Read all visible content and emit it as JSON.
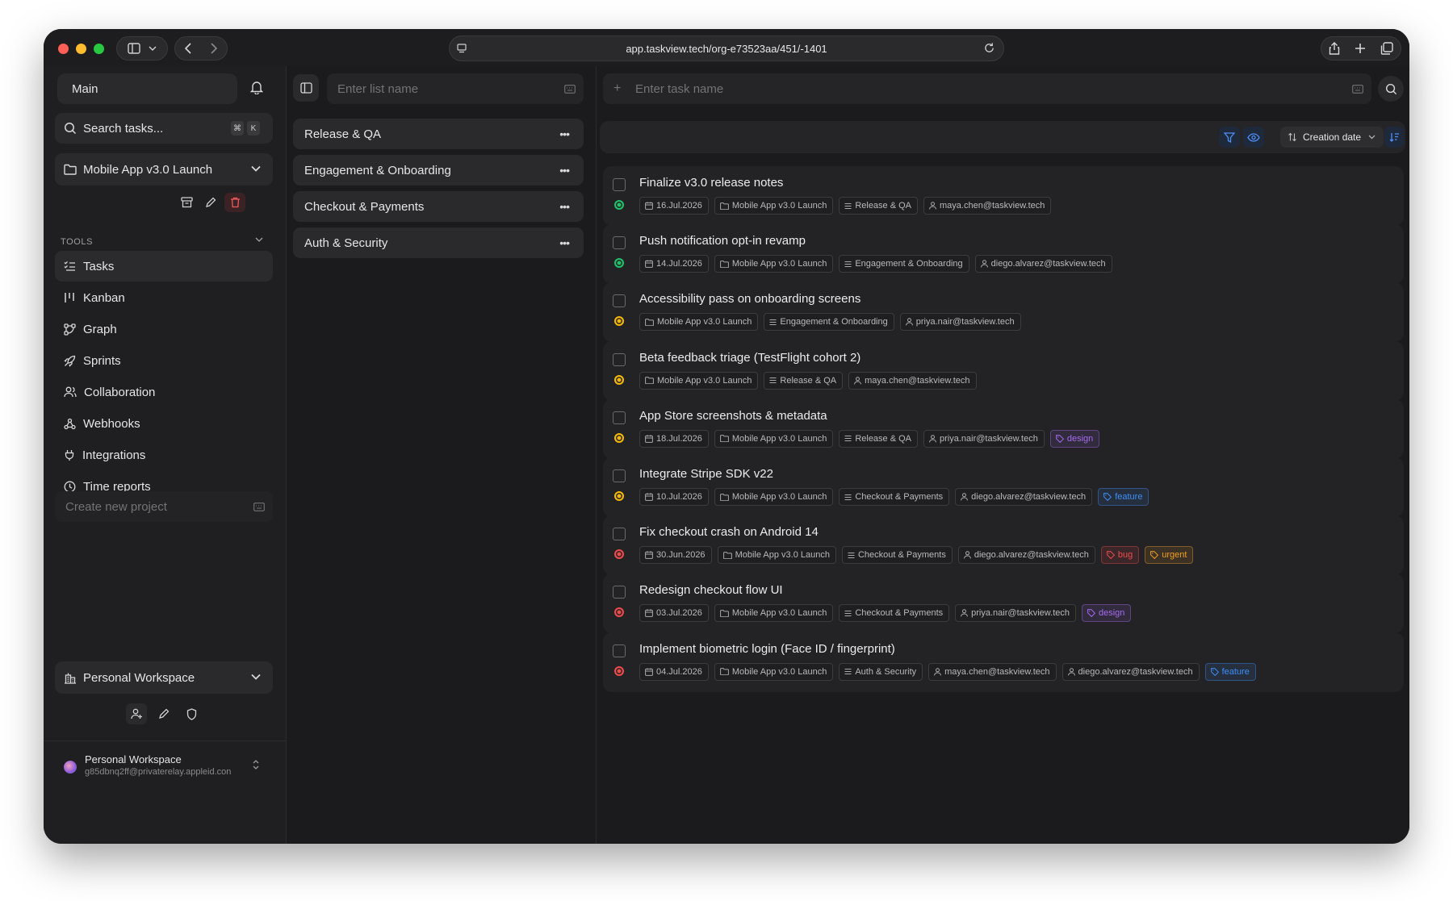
{
  "browser": {
    "url": "app.taskview.tech/org-e73523aa/451/-1401"
  },
  "sidebar": {
    "main_label": "Main",
    "search_placeholder": "Search tasks...",
    "search_kbd": [
      "⌘",
      "K"
    ],
    "project_name": "Mobile App v3.0 Launch",
    "tools_heading": "TOOLS",
    "nav": [
      {
        "label": "Tasks",
        "icon": "tasks-icon"
      },
      {
        "label": "Kanban",
        "icon": "kanban-icon"
      },
      {
        "label": "Graph",
        "icon": "graph-icon"
      },
      {
        "label": "Sprints",
        "icon": "rocket-icon"
      },
      {
        "label": "Collaboration",
        "icon": "users-icon"
      },
      {
        "label": "Webhooks",
        "icon": "webhook-icon"
      },
      {
        "label": "Integrations",
        "icon": "plug-icon"
      },
      {
        "label": "Time reports",
        "icon": "clock-icon"
      }
    ],
    "new_project_placeholder": "Create new project",
    "workspace": "Personal Workspace",
    "user": {
      "name": "Personal Workspace",
      "email": "g85dbnq2ff@privaterelay.appleid.con"
    }
  },
  "lists": {
    "placeholder": "Enter list name",
    "items": [
      "Release & QA",
      "Engagement & Onboarding",
      "Checkout & Payments",
      "Auth & Security"
    ]
  },
  "tasks": {
    "placeholder": "Enter task name",
    "sort_label": "Creation date",
    "colors": {
      "green": "#1fc16b",
      "yellow": "#f5b800",
      "red": "#ef4b4b",
      "purple": "#a66bf0",
      "blue": "#3e8ef7",
      "orange": "#f0a020"
    },
    "items": [
      {
        "title": "Finalize v3.0 release notes",
        "status": "green",
        "date": "16.Jul.2026",
        "project": "Mobile App v3.0 Launch",
        "list": "Release & QA",
        "assignees": [
          "maya.chen@taskview.tech"
        ],
        "tags": []
      },
      {
        "title": "Push notification opt-in revamp",
        "status": "green",
        "date": "14.Jul.2026",
        "project": "Mobile App v3.0 Launch",
        "list": "Engagement & Onboarding",
        "assignees": [
          "diego.alvarez@taskview.tech"
        ],
        "tags": []
      },
      {
        "title": "Accessibility pass on onboarding screens",
        "status": "yellow",
        "date": "",
        "project": "Mobile App v3.0 Launch",
        "list": "Engagement & Onboarding",
        "assignees": [
          "priya.nair@taskview.tech"
        ],
        "tags": []
      },
      {
        "title": "Beta feedback triage (TestFlight cohort 2)",
        "status": "yellow",
        "date": "",
        "project": "Mobile App v3.0 Launch",
        "list": "Release & QA",
        "assignees": [
          "maya.chen@taskview.tech"
        ],
        "tags": []
      },
      {
        "title": "App Store screenshots & metadata",
        "status": "yellow",
        "date": "18.Jul.2026",
        "project": "Mobile App v3.0 Launch",
        "list": "Release & QA",
        "assignees": [
          "priya.nair@taskview.tech"
        ],
        "tags": [
          {
            "label": "design",
            "color": "purple"
          }
        ]
      },
      {
        "title": "Integrate Stripe SDK v22",
        "status": "yellow",
        "date": "10.Jul.2026",
        "project": "Mobile App v3.0 Launch",
        "list": "Checkout & Payments",
        "assignees": [
          "diego.alvarez@taskview.tech"
        ],
        "tags": [
          {
            "label": "feature",
            "color": "blue"
          }
        ]
      },
      {
        "title": "Fix checkout crash on Android 14",
        "status": "red",
        "date": "30.Jun.2026",
        "project": "Mobile App v3.0 Launch",
        "list": "Checkout & Payments",
        "assignees": [
          "diego.alvarez@taskview.tech"
        ],
        "tags": [
          {
            "label": "bug",
            "color": "red"
          },
          {
            "label": "urgent",
            "color": "orange"
          }
        ]
      },
      {
        "title": "Redesign checkout flow UI",
        "status": "red",
        "date": "03.Jul.2026",
        "project": "Mobile App v3.0 Launch",
        "list": "Checkout & Payments",
        "assignees": [
          "priya.nair@taskview.tech"
        ],
        "tags": [
          {
            "label": "design",
            "color": "purple"
          }
        ]
      },
      {
        "title": "Implement biometric login (Face ID / fingerprint)",
        "status": "red",
        "date": "04.Jul.2026",
        "project": "Mobile App v3.0 Launch",
        "list": "Auth & Security",
        "assignees": [
          "maya.chen@taskview.tech",
          "diego.alvarez@taskview.tech"
        ],
        "tags": [
          {
            "label": "feature",
            "color": "blue"
          }
        ]
      }
    ]
  }
}
